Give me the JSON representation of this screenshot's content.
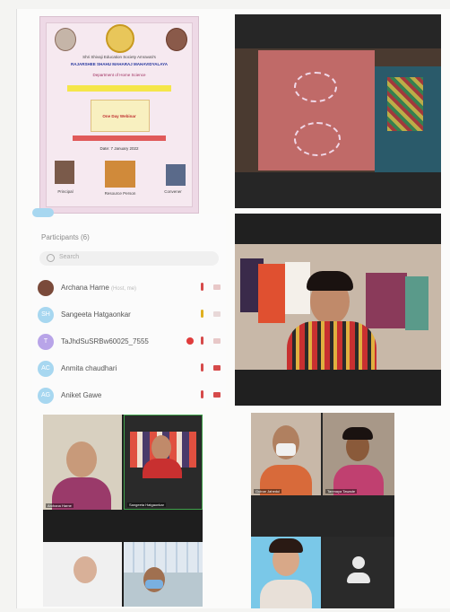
{
  "poster": {
    "title_line1": "Shri Shivaji Education Society Amravati's",
    "title_line2": "RAJARSHEE SHAHU MAHARAJ MAHAVIDYALAYA",
    "subtitle": "Department of Home Science",
    "event_line": "One Day Webinar",
    "date_line": "Date: 7 January 2022",
    "speakers": [
      "Principal",
      "Resource Person",
      "Convener"
    ]
  },
  "participants": {
    "header": "Participants (6)",
    "search_placeholder": "Search",
    "list": [
      {
        "initials": "",
        "name": "Archana Harne",
        "tag": "(Host, me)",
        "avatar_color": "#7a4a3a",
        "mic_color": "#d64a4a",
        "cam_color": "#d64a4a",
        "alert": false
      },
      {
        "initials": "SH",
        "name": "Sangeeta Hatgaonkar",
        "tag": "",
        "avatar_color": "#a7d7f0",
        "mic_color": "#e0b020",
        "cam_color": "#d7a0a0",
        "alert": false
      },
      {
        "initials": "T",
        "name": "TaJhdSuSRBw60025_7555",
        "tag": "",
        "avatar_color": "#b8a4e8",
        "mic_color": "#d64a4a",
        "cam_color": "#d64a4a",
        "alert": true
      },
      {
        "initials": "AC",
        "name": "Anmita chaudhari",
        "tag": "",
        "avatar_color": "#a7d7f0",
        "mic_color": "#d64a4a",
        "cam_color": "#d64a4a",
        "alert": false
      },
      {
        "initials": "AG",
        "name": "Aniket Gawe",
        "tag": "",
        "avatar_color": "#a7d7f0",
        "mic_color": "#d64a4a",
        "cam_color": "#d64a4a",
        "alert": false
      }
    ]
  },
  "grid_left": {
    "tiles": [
      "Archana Harne",
      "Sangeeta Hatgaonkar",
      "",
      ""
    ]
  },
  "grid_right": {
    "tiles": [
      "Gulnar Jahedul",
      "Tanmaya Tawade",
      "",
      ""
    ]
  }
}
